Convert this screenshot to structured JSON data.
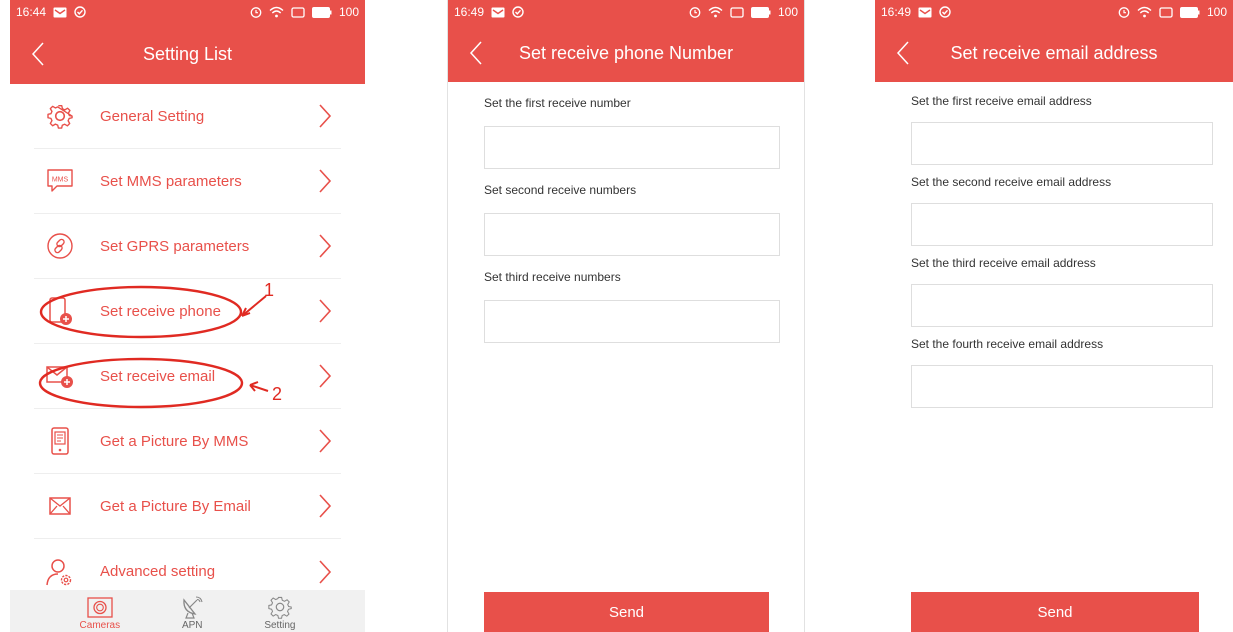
{
  "colors": {
    "accent": "#e8504a",
    "tabbar": "#f1f1f1"
  },
  "screen1": {
    "status": {
      "time": "16:44",
      "battery": "100"
    },
    "title": "Setting List",
    "items": [
      {
        "label": "General Setting",
        "icon": "gear-icon"
      },
      {
        "label": "Set MMS parameters",
        "icon": "mms-icon"
      },
      {
        "label": "Set GPRS parameters",
        "icon": "link-icon"
      },
      {
        "label": "Set receive phone",
        "icon": "add-phone-icon"
      },
      {
        "label": "Set receive email",
        "icon": "add-email-icon"
      },
      {
        "label": "Get a Picture By MMS",
        "icon": "phone-document-icon"
      },
      {
        "label": "Get a Picture By Email",
        "icon": "envelope-icon"
      },
      {
        "label": "Advanced setting",
        "icon": "user-gear-icon"
      }
    ],
    "annotations": {
      "first": "1",
      "second": "2"
    },
    "tabs": [
      {
        "label": "Cameras",
        "icon": "camera-icon",
        "active": true
      },
      {
        "label": "APN",
        "icon": "satellite-dish-icon",
        "active": false
      },
      {
        "label": "Setting",
        "icon": "gear-icon",
        "active": false
      }
    ]
  },
  "screen2": {
    "status": {
      "time": "16:49",
      "battery": "100"
    },
    "title": "Set receive phone Number",
    "fields": [
      {
        "label": "Set the first receive number",
        "value": ""
      },
      {
        "label": "Set second receive numbers",
        "value": ""
      },
      {
        "label": "Set third receive numbers",
        "value": ""
      }
    ],
    "send_label": "Send"
  },
  "screen3": {
    "status": {
      "time": "16:49",
      "battery": "100"
    },
    "title": "Set receive email address",
    "fields": [
      {
        "label": "Set the first receive email address",
        "value": ""
      },
      {
        "label": "Set the second receive email address",
        "value": ""
      },
      {
        "label": "Set the third receive email address",
        "value": ""
      },
      {
        "label": "Set the fourth receive email address",
        "value": ""
      }
    ],
    "send_label": "Send"
  }
}
